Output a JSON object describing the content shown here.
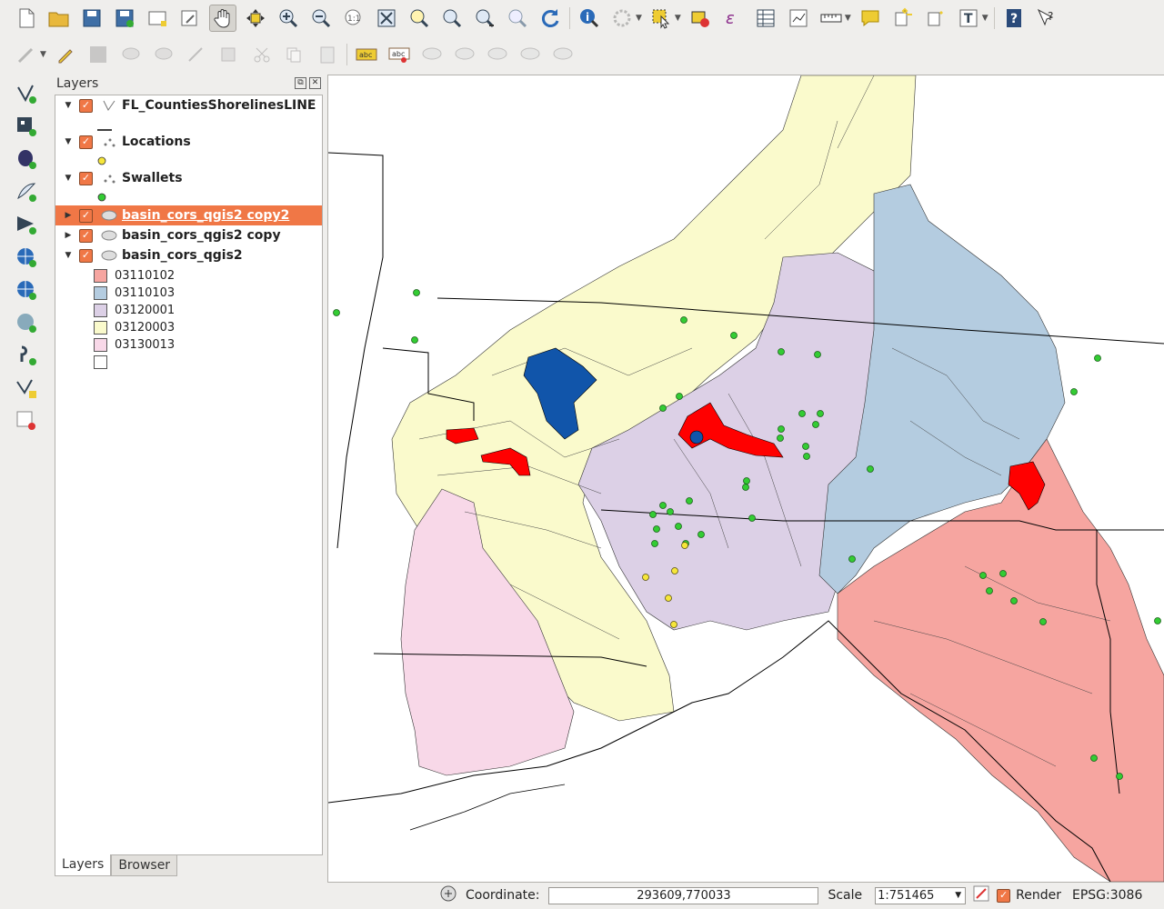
{
  "panel": {
    "title": "Layers",
    "float_btn": "⧉",
    "close_btn": "✕"
  },
  "layers": [
    {
      "name": "FL_CountiesShorelinesLINE",
      "symbol": "line"
    },
    {
      "name": "Locations",
      "symbol": "point",
      "color": "#f6e63a"
    },
    {
      "name": "Swallets",
      "symbol": "point",
      "color": "#33cc33"
    },
    {
      "name": "basin_cors_qgis2 copy2",
      "symbol": "polygon",
      "selected": true
    },
    {
      "name": "basin_cors_qgis2 copy",
      "symbol": "polygon"
    },
    {
      "name": "basin_cors_qgis2",
      "symbol": "polygon"
    }
  ],
  "categories": [
    {
      "label": "03110102",
      "color": "#f6a5a0"
    },
    {
      "label": "03110103",
      "color": "#b4cce0"
    },
    {
      "label": "03120001",
      "color": "#dcd0e6"
    },
    {
      "label": "03120003",
      "color": "#fafacc"
    },
    {
      "label": "03130013",
      "color": "#f8d8e8"
    },
    {
      "label": "",
      "color": "#ffffff"
    }
  ],
  "tabs": {
    "layers": "Layers",
    "browser": "Browser"
  },
  "status": {
    "coordinate_label": "Coordinate:",
    "coordinate_value": "293609,770033",
    "scale_label": "Scale",
    "scale_value": "1:751465",
    "render_label": "Render",
    "crs": "EPSG:3086"
  },
  "colors": {
    "accent": "#f07746",
    "basin_red": "#ff0000",
    "basin_blue": "#1155aa"
  },
  "toolbar_icons": [
    "new-project-icon",
    "open-project-icon",
    "save-project-icon",
    "save-as-icon",
    "new-print-composer-icon",
    "composer-manager-icon",
    "pan-icon",
    "pan-to-selection-icon",
    "zoom-in-icon",
    "zoom-out-icon",
    "zoom-native-icon",
    "zoom-full-icon",
    "zoom-to-selection-icon",
    "zoom-to-layer-icon",
    "zoom-last-icon",
    "zoom-next-icon",
    "refresh-icon",
    "identify-icon",
    "action-icon",
    "select-features-icon",
    "deselect-icon",
    "field-calculator-icon",
    "attribute-table-icon",
    "statistics-icon",
    "measure-icon",
    "map-tips-icon",
    "new-bookmark-icon",
    "show-bookmarks-icon",
    "text-annotation-icon",
    "help-icon",
    "whats-this-icon"
  ]
}
